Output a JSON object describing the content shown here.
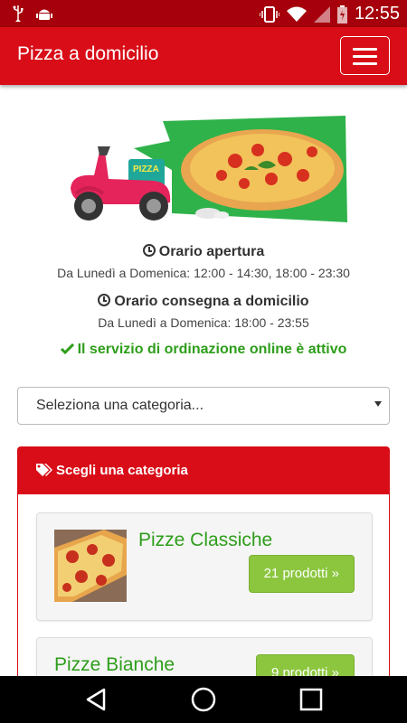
{
  "status_bar": {
    "time": "12:55",
    "icons": [
      "usb-icon",
      "android-debug-icon",
      "vibrate-icon",
      "wifi-icon",
      "signal-icon",
      "battery-charging-icon"
    ]
  },
  "app_bar": {
    "title": "Pizza a domicilio",
    "menu_icon": "hamburger-icon"
  },
  "hero": {
    "scooter_label": "PIZZA"
  },
  "opening_hours": {
    "title": "Orario apertura",
    "value": "Da Lunedì a Domenica: 12:00 - 14:30, 18:00 - 23:30"
  },
  "delivery_hours": {
    "title": "Orario consegna a domicilio",
    "value": "Da Lunedì a Domenica: 18:00 - 23:55"
  },
  "service_status": "Il servizio di ordinazione online è attivo",
  "category_select": {
    "selected": "Seleziona una categoria..."
  },
  "category_panel": {
    "title": "Scegli una categoria",
    "items": [
      {
        "name": "Pizze Classiche",
        "button": "21 prodotti »"
      },
      {
        "name": "Pizze Bianche",
        "button": "9 prodotti »"
      }
    ]
  },
  "colors": {
    "brand_red": "#d80d18",
    "status_red": "#a5000b",
    "accent_green": "#2e9e1b",
    "button_green": "#8cc63f"
  }
}
